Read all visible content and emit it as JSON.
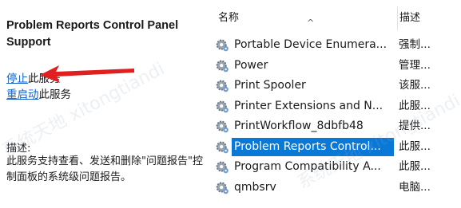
{
  "left_panel": {
    "service_title": "Problem Reports Control Panel Support",
    "stop_link": "停止",
    "stop_suffix": "此服务",
    "restart_link": "重启动",
    "restart_suffix": "此服务",
    "description_label": "描述:",
    "description_text": "此服务支持查看、发送和删除\"问题报告\"控制面板的系统级问题报告。"
  },
  "services_list": {
    "header_name": "名称",
    "header_desc": "描述",
    "rows": [
      {
        "name": "Portable Device Enumera...",
        "desc": "强制..."
      },
      {
        "name": "Power",
        "desc": "管理..."
      },
      {
        "name": "Print Spooler",
        "desc": "该服..."
      },
      {
        "name": "Printer Extensions and N...",
        "desc": "此服..."
      },
      {
        "name": "PrintWorkflow_8dbfb48",
        "desc": "提供..."
      },
      {
        "name": "Problem Reports Control...",
        "desc": "此服..."
      },
      {
        "name": "Program Compatibility A...",
        "desc": "此服..."
      },
      {
        "name": "qmbsrv",
        "desc": "电脑..."
      }
    ],
    "selected_index": 5
  },
  "watermark_text": "系统天地 xitongtiandi",
  "colors": {
    "link": "#1660c0",
    "selection": "#0a78d7",
    "arrow": "#e02020"
  }
}
